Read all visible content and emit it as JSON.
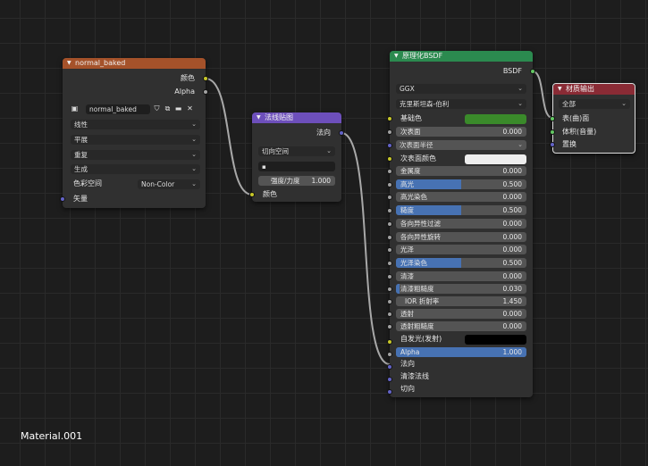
{
  "material_name": "Material.001",
  "colors": {
    "image_header": "#a5522a",
    "normal_header": "#6d4fbb",
    "bsdf_header": "#2b8a4f",
    "output_header": "#8a2b35",
    "socket_color": "#c7c729",
    "socket_float": "#a1a1a1",
    "socket_vector": "#6363c7",
    "socket_shader": "#63c763",
    "base_color_swatch": "#3a8a2a"
  },
  "image_node": {
    "title": "normal_baked",
    "outputs": [
      "颜色",
      "Alpha"
    ],
    "image_name": "normal_baked",
    "interpolation": "线性",
    "projection": "平展",
    "extension": "重复",
    "source": "生成",
    "color_space_label": "色彩空间",
    "color_space_value": "Non-Color",
    "input_vector": "矢量"
  },
  "normal_node": {
    "title": "法线贴图",
    "output": "法向",
    "space": "切向空间",
    "uv": "",
    "strength_label": "强度/力度",
    "strength_value": "1.000",
    "input_color": "颜色"
  },
  "bsdf_node": {
    "title": "原理化BSDF",
    "output": "BSDF",
    "distribution": "GGX",
    "subsurface_method": "克里斯坦森-伯利",
    "base_color_label": "基础色",
    "subsurface_label": "次表面",
    "subsurface_value": "0.000",
    "subsurface_radius_label": "次表面半径",
    "subsurface_color_label": "次表面颜色",
    "metallic_label": "金属度",
    "metallic_value": "0.000",
    "specular_label": "高光",
    "specular_value": "0.500",
    "specular_tint_label": "高光染色",
    "specular_tint_value": "0.000",
    "roughness_label": "糙度",
    "roughness_value": "0.500",
    "anisotropic_label": "各向异性过滤",
    "anisotropic_value": "0.000",
    "anisotropic_rotation_label": "各向异性旋转",
    "anisotropic_rotation_value": "0.000",
    "sheen_label": "光泽",
    "sheen_value": "0.000",
    "sheen_tint_label": "光泽染色",
    "sheen_tint_value": "0.500",
    "clearcoat_label": "清漆",
    "clearcoat_value": "0.000",
    "clearcoat_roughness_label": "清漆粗糙度",
    "clearcoat_roughness_value": "0.030",
    "ior_label": "IOR 折射率",
    "ior_value": "1.450",
    "transmission_label": "透射",
    "transmission_value": "0.000",
    "transmission_roughness_label": "透射粗糙度",
    "transmission_roughness_value": "0.000",
    "emission_label": "自发光(发射)",
    "alpha_label": "Alpha",
    "alpha_value": "1.000",
    "normal_label": "法向",
    "clearcoat_normal_label": "清漆法线",
    "tangent_label": "切向"
  },
  "output_node": {
    "title": "材质输出",
    "target": "全部",
    "surface": "表(曲)面",
    "volume": "体积(音量)",
    "displacement": "置换"
  }
}
